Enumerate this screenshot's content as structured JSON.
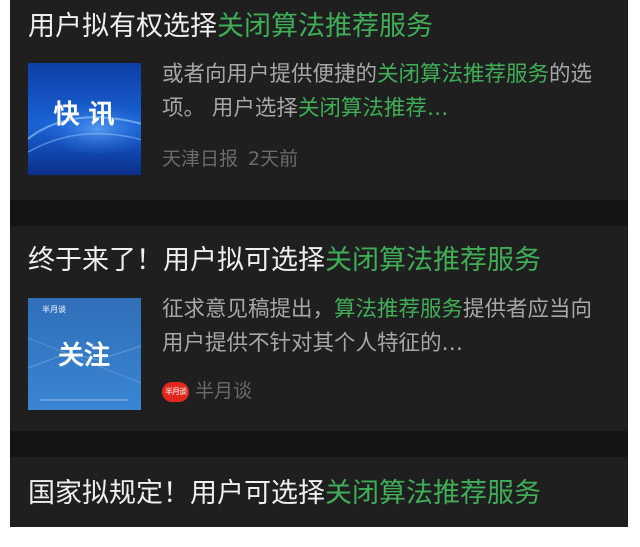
{
  "feed": {
    "items": [
      {
        "title_plain": "用户拟有权选择",
        "title_highlight": "关闭算法推荐服务",
        "thumbnail": {
          "text": "快 讯",
          "icon": "news-flash-thumbnail"
        },
        "snippet": [
          {
            "text": "或者向用户提供便捷的",
            "hl": false
          },
          {
            "text": "关闭算法推荐服务",
            "hl": true
          },
          {
            "text": "的选项。 用户选择",
            "hl": false
          },
          {
            "text": "关闭算法推荐…",
            "hl": true
          }
        ],
        "source": "天津日报",
        "time": "2天前"
      },
      {
        "title_plain": "终于来了！用户拟可选择",
        "title_highlight": "关闭算法推荐服务",
        "thumbnail": {
          "text": "关注",
          "small_logo": "半月谈",
          "icon": "follow-thumbnail"
        },
        "snippet": [
          {
            "text": "征求意见稿提出，",
            "hl": false
          },
          {
            "text": "算法推荐服务",
            "hl": true
          },
          {
            "text": "提供者应当向用户提供不针对其个人特征的…",
            "hl": false
          }
        ],
        "source_logo_text": "半月谈",
        "source": "半月谈"
      },
      {
        "title_plain": "国家拟规定！用户可选择",
        "title_highlight": "关闭算法推荐服务"
      }
    ]
  }
}
